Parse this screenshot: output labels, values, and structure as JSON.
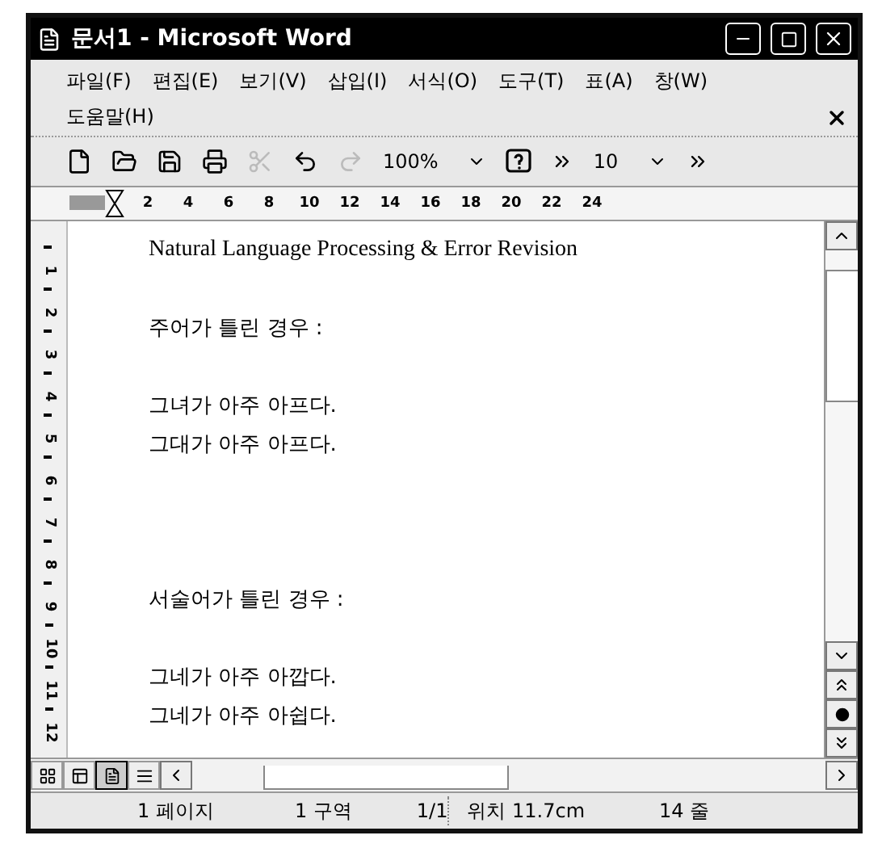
{
  "window": {
    "title": "문서1 - Microsoft Word"
  },
  "menu": [
    {
      "label": "파일(F)"
    },
    {
      "label": "편집(E)"
    },
    {
      "label": "보기(V)"
    },
    {
      "label": "삽입(I)"
    },
    {
      "label": "서식(O)"
    },
    {
      "label": "도구(T)"
    },
    {
      "label": "표(A)"
    },
    {
      "label": "창(W)"
    },
    {
      "label": "도움말(H)"
    }
  ],
  "toolbar": [
    {
      "kind": "new",
      "disabled": false
    },
    {
      "kind": "open",
      "disabled": false
    },
    {
      "kind": "save",
      "disabled": false
    },
    {
      "kind": "print",
      "disabled": false
    },
    {
      "kind": "cut",
      "disabled": true
    },
    {
      "kind": "undo",
      "disabled": false
    },
    {
      "kind": "redo",
      "disabled": true
    },
    {
      "kind": "zoom",
      "value": "100%"
    },
    {
      "kind": "help",
      "disabled": false
    },
    {
      "kind": "more"
    },
    {
      "kind": "font_size",
      "value": "10"
    },
    {
      "kind": "more"
    }
  ],
  "ruler": {
    "numbers": [
      "2",
      "4",
      "6",
      "8",
      "10",
      "12",
      "14",
      "16",
      "18",
      "20",
      "22",
      "24"
    ],
    "vertical_numbers": [
      "1",
      "2",
      "3",
      "4",
      "5",
      "6",
      "7",
      "8",
      "9",
      "10",
      "11",
      "12"
    ]
  },
  "document": {
    "lines": [
      {
        "kind": "heading",
        "text": "Natural Language Processing & Error Revision"
      },
      {
        "kind": "blank"
      },
      {
        "kind": "text",
        "text": "주어가 틀린 경우 :"
      },
      {
        "kind": "blank"
      },
      {
        "kind": "text",
        "text": "그녀가 아주 아프다."
      },
      {
        "kind": "text",
        "text": "그대가 아주 아프다."
      },
      {
        "kind": "blank"
      },
      {
        "kind": "blank"
      },
      {
        "kind": "blank"
      },
      {
        "kind": "text",
        "text": "서술어가 틀린 경우 :"
      },
      {
        "kind": "blank"
      },
      {
        "kind": "text",
        "text": "그네가 아주 아깝다."
      },
      {
        "kind": "text",
        "text": "그네가 아주 아쉽다."
      }
    ]
  },
  "view_buttons": [
    {
      "selected": false
    },
    {
      "selected": false
    },
    {
      "selected": true
    },
    {
      "selected": false
    }
  ],
  "status_bar": [
    {
      "text": "1 페이지"
    },
    {
      "text": "1 구역"
    },
    {
      "text": "1/1"
    },
    {
      "text": "위치 11.7cm"
    },
    {
      "text": "14 줄"
    }
  ]
}
